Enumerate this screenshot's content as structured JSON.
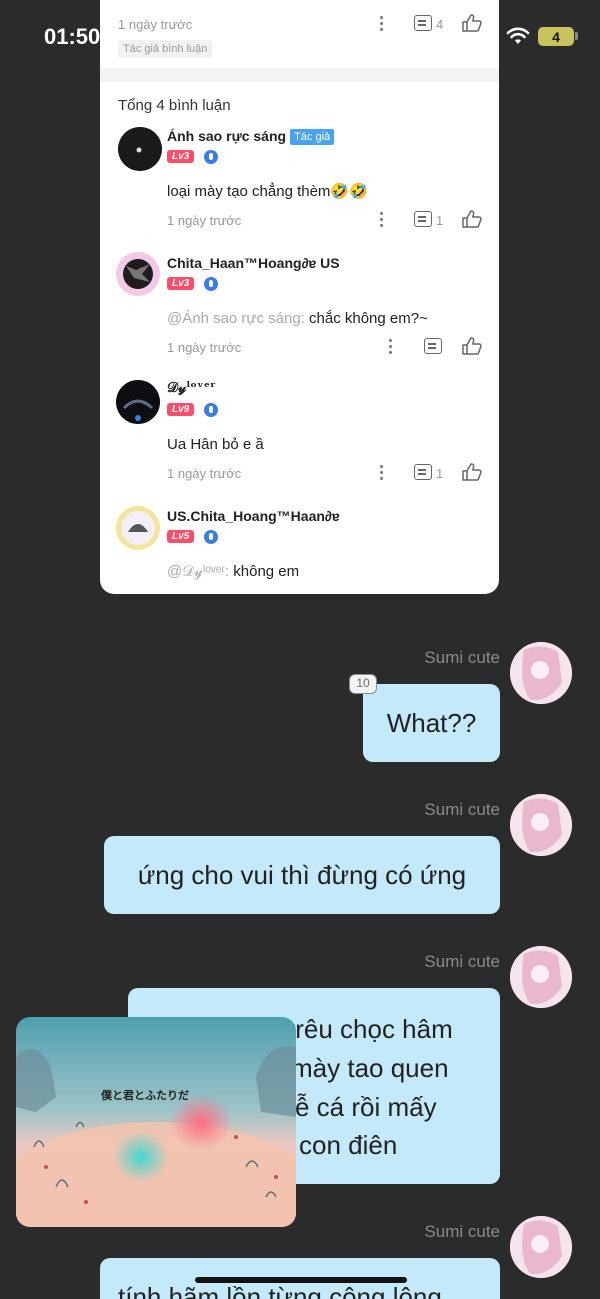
{
  "status_bar": {
    "time": "01:50",
    "battery": "4"
  },
  "post_card": {
    "top_time": "1 ngày trước",
    "top_comment_count": "4",
    "author_comment_tag": "Tác giả bình luận",
    "total_label": "Tổng 4 bình luận",
    "comments": [
      {
        "name": "Ánh sao rực sáng",
        "tag": "Tác giả",
        "level": "Lv3",
        "text": "loại mày tạo chẳng thèm🤣🤣",
        "time": "1 ngày trước",
        "replies": "1"
      },
      {
        "name": "Chita_Haan™Hoang∂ɐ US",
        "level": "Lv3",
        "mention": "@Ánh sao rực sáng:",
        "text": " chắc không em?~",
        "time": "1 ngày trước"
      },
      {
        "name": "𝒟𝓎ˡᵒᵛᵉʳ",
        "level": "Lv9",
        "text": "Ua Hân bỏ e ầ",
        "time": "1 ngày trước",
        "replies": "1"
      },
      {
        "name": "US.Chita_Hoang™Haan∂ɐ",
        "level": "Lv5",
        "mention": "@𝒟𝓎ˡᵒᵛᵉʳ:",
        "text": " không em"
      }
    ]
  },
  "chat": {
    "sender": "Sumi cute",
    "reply_count": "10",
    "messages": [
      {
        "text": "What??"
      },
      {
        "text": "ứng cho vui thì đừng có ứng"
      },
      {
        "lines": [
          "trêu chọc hâm",
          "mày tao quen",
          "ễ cá rồi mấy",
          "con điên"
        ]
      },
      {
        "text": "tính hãm lồn từng công lông"
      }
    ],
    "sticker_text": "僕と君とふたりだ"
  }
}
